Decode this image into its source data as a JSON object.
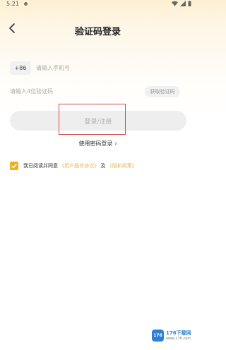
{
  "status_bar": {
    "time": "5:21"
  },
  "header": {
    "title": "验证码登录"
  },
  "phone": {
    "country_code": "+86",
    "placeholder": "请输入手机号"
  },
  "code": {
    "placeholder": "请输入4位验证码",
    "get_code_label": "获取验证码"
  },
  "login_button": {
    "label": "登录/注册"
  },
  "password_login": {
    "label": "使用密码登录",
    "arrow": "›"
  },
  "agreement": {
    "checked": true,
    "prefix": "我已阅读并同意",
    "link1": "《用户服务协议》",
    "joiner": "及",
    "link2": "《隐私政策》"
  },
  "watermark": {
    "badge": "176",
    "title": "176下载网",
    "subtitle": "www.176.com"
  },
  "colors": {
    "accent": "#f0b11d",
    "link": "#e8b84a",
    "highlight": "#d24848"
  },
  "icons": {
    "back": "chevron-left-icon",
    "wifi": "wifi-icon",
    "signal": "signal-icon",
    "battery": "battery-icon",
    "check": "check-icon"
  }
}
